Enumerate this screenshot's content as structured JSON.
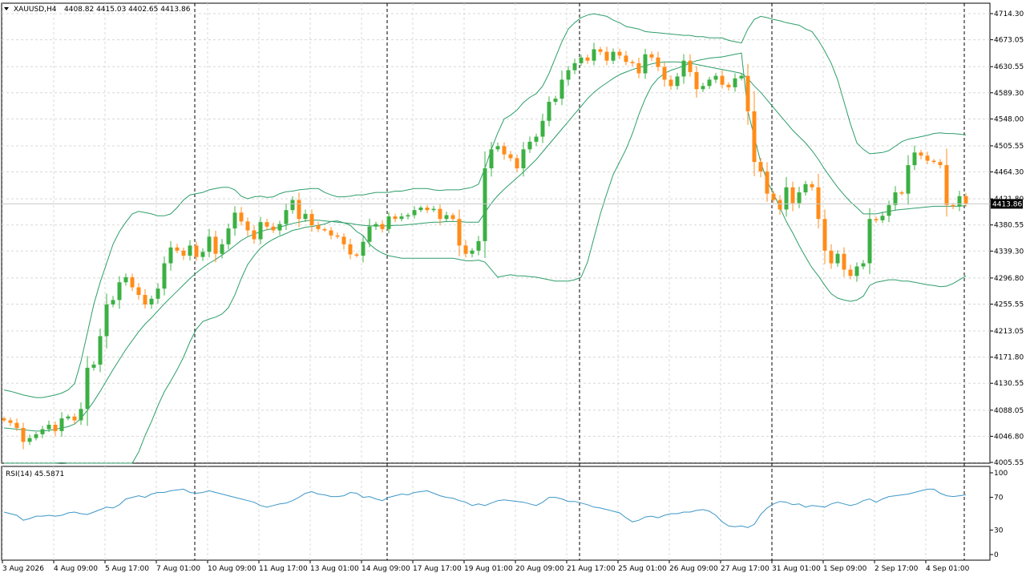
{
  "header": {
    "symbol_timeframe": "XAUUSD,H4",
    "ohlc": "4408.82 4415.03 4402.65 4413.86"
  },
  "price_axis": {
    "labels": [
      "4714.30",
      "4673.05",
      "4630.55",
      "4589.30",
      "4548.00",
      "4505.55",
      "4464.30",
      "4421.80",
      "4380.55",
      "4339.30",
      "4296.80",
      "4255.55",
      "4213.05",
      "4171.80",
      "4130.55",
      "4088.05",
      "4046.80",
      "4005.55"
    ],
    "current_price": "4413.86"
  },
  "rsi_panel": {
    "title": "RSI(14) 45.5871",
    "labels": [
      "100",
      "70",
      "30",
      "0"
    ],
    "levels": [
      100,
      70,
      30,
      0
    ]
  },
  "time_axis": {
    "labels": [
      "3 Aug 2026",
      "4 Aug 09:00",
      "5 Aug 17:00",
      "7 Aug 01:00",
      "10 Aug 09:00",
      "11 Aug 17:00",
      "13 Aug 01:00",
      "14 Aug 09:00",
      "17 Aug 17:00",
      "19 Aug 01:00",
      "20 Aug 09:00",
      "21 Aug 17:00",
      "25 Aug 01:00",
      "26 Aug 09:00",
      "27 Aug 17:00",
      "31 Aug 01:00",
      "1 Sep 09:00",
      "2 Sep 17:00",
      "4 Sep 01:00"
    ]
  },
  "colors": {
    "bull": "#3cb043",
    "bear": "#ff8c1a",
    "band": "#2e9e6a",
    "rsi": "#3c96c8",
    "grid": "#d8d8d8",
    "separator": "#000000"
  },
  "chart_data": {
    "type": "candlestick",
    "timeframe": "H4",
    "ylim": [
      4005.55,
      4714.3
    ],
    "bull_color": "#3cb043",
    "bear_color": "#ff8c1a",
    "close": [
      4072,
      4068,
      4060,
      4038,
      4044,
      4050,
      4058,
      4065,
      4055,
      4075,
      4078,
      4072,
      4090,
      4155,
      4160,
      4205,
      4255,
      4262,
      4290,
      4298,
      4282,
      4270,
      4255,
      4264,
      4280,
      4320,
      4345,
      4340,
      4332,
      4348,
      4330,
      4338,
      4362,
      4335,
      4350,
      4375,
      4400,
      4386,
      4372,
      4358,
      4385,
      4378,
      4372,
      4382,
      4404,
      4420,
      4390,
      4398,
      4380,
      4374,
      4372,
      4364,
      4362,
      4350,
      4334,
      4332,
      4354,
      4378,
      4382,
      4374,
      4394,
      4390,
      4394,
      4396,
      4404,
      4408,
      4404,
      4406,
      4390,
      4396,
      4390,
      4348,
      4335,
      4340,
      4355,
      4470,
      4500,
      4505,
      4492,
      4486,
      4470,
      4500,
      4512,
      4520,
      4545,
      4575,
      4580,
      4610,
      4625,
      4636,
      4645,
      4640,
      4658,
      4654,
      4640,
      4654,
      4648,
      4638,
      4636,
      4620,
      4650,
      4645,
      4630,
      4610,
      4600,
      4615,
      4640,
      4622,
      4595,
      4600,
      4610,
      4616,
      4602,
      4598,
      4612,
      4616,
      4560,
      4480,
      4465,
      4430,
      4420,
      4405,
      4440,
      4415,
      4432,
      4445,
      4440,
      4390,
      4340,
      4320,
      4335,
      4310,
      4300,
      4315,
      4320,
      4390,
      4388,
      4395,
      4412,
      4432,
      4430,
      4475,
      4495,
      4490,
      4482,
      4480,
      4475,
      4412,
      4410,
      4426,
      4414
    ],
    "bollinger": {
      "upper": [
        4120,
        4118,
        4115,
        4112,
        4110,
        4108,
        4108,
        4110,
        4112,
        4115,
        4120,
        4130,
        4165,
        4210,
        4255,
        4290,
        4320,
        4350,
        4370,
        4385,
        4398,
        4402,
        4400,
        4398,
        4395,
        4395,
        4398,
        4408,
        4420,
        4428,
        4430,
        4432,
        4436,
        4438,
        4440,
        4440,
        4436,
        4426,
        4422,
        4425,
        4426,
        4424,
        4425,
        4430,
        4433,
        4434,
        4436,
        4437,
        4438,
        4438,
        4432,
        4428,
        4425,
        4425,
        4426,
        4428,
        4428,
        4430,
        4432,
        4432,
        4432,
        4434,
        4434,
        4436,
        4438,
        4438,
        4438,
        4436,
        4435,
        4436,
        4436,
        4436,
        4438,
        4440,
        4445,
        4470,
        4500,
        4526,
        4548,
        4554,
        4562,
        4574,
        4582,
        4588,
        4600,
        4620,
        4645,
        4670,
        4690,
        4700,
        4708,
        4712,
        4714,
        4712,
        4710,
        4704,
        4700,
        4694,
        4692,
        4690,
        4686,
        4685,
        4684,
        4683,
        4682,
        4681,
        4680,
        4680,
        4678,
        4678,
        4676,
        4676,
        4676,
        4672,
        4670,
        4668,
        4690,
        4705,
        4710,
        4708,
        4705,
        4703,
        4700,
        4698,
        4696,
        4690,
        4686,
        4672,
        4655,
        4636,
        4610,
        4575,
        4540,
        4510,
        4500,
        4493,
        4494,
        4495,
        4498,
        4505,
        4512,
        4516,
        4518,
        4520,
        4522,
        4525,
        4526,
        4525,
        4525,
        4524,
        4523
      ],
      "middle": [
        4060,
        4059,
        4058,
        4057,
        4056,
        4055,
        4055,
        4056,
        4058,
        4060,
        4062,
        4066,
        4075,
        4088,
        4102,
        4118,
        4135,
        4152,
        4168,
        4184,
        4198,
        4212,
        4224,
        4234,
        4245,
        4256,
        4266,
        4276,
        4286,
        4296,
        4305,
        4313,
        4320,
        4326,
        4333,
        4340,
        4348,
        4356,
        4362,
        4366,
        4370,
        4373,
        4375,
        4377,
        4380,
        4383,
        4385,
        4387,
        4388,
        4388,
        4387,
        4386,
        4385,
        4384,
        4383,
        4381,
        4380,
        4379,
        4379,
        4379,
        4379,
        4380,
        4380,
        4381,
        4382,
        4383,
        4384,
        4385,
        4385,
        4386,
        4386,
        4386,
        4385,
        4385,
        4385,
        4400,
        4415,
        4427,
        4437,
        4446,
        4455,
        4464,
        4474,
        4484,
        4496,
        4508,
        4520,
        4532,
        4544,
        4556,
        4568,
        4580,
        4590,
        4598,
        4605,
        4612,
        4618,
        4622,
        4626,
        4629,
        4632,
        4635,
        4637,
        4638,
        4638,
        4638,
        4637,
        4636,
        4634,
        4632,
        4630,
        4628,
        4626,
        4624,
        4622,
        4620,
        4612,
        4600,
        4590,
        4578,
        4566,
        4554,
        4542,
        4530,
        4520,
        4510,
        4498,
        4484,
        4468,
        4454,
        4440,
        4428,
        4417,
        4408,
        4398,
        4398,
        4398,
        4400,
        4402,
        4404,
        4405,
        4406,
        4407,
        4408,
        4409,
        4410,
        4410,
        4410,
        4410,
        4410,
        4411
      ],
      "lower": [
        4000,
        4000,
        4001,
        4002,
        4003,
        4002,
        4002,
        4002,
        4004,
        4005,
        4004,
        4002,
        3985,
        3966,
        3949,
        3946,
        3950,
        3954,
        3966,
        3983,
        3998,
        4022,
        4048,
        4070,
        4095,
        4117,
        4134,
        4152,
        4172,
        4196,
        4216,
        4228,
        4232,
        4235,
        4240,
        4250,
        4270,
        4296,
        4318,
        4332,
        4344,
        4352,
        4358,
        4363,
        4367,
        4372,
        4374,
        4377,
        4378,
        4380,
        4382,
        4386,
        4387,
        4384,
        4380,
        4370,
        4364,
        4350,
        4342,
        4336,
        4332,
        4330,
        4328,
        4328,
        4328,
        4328,
        4328,
        4328,
        4328,
        4328,
        4328,
        4326,
        4324,
        4324,
        4325,
        4322,
        4310,
        4298,
        4300,
        4302,
        4300,
        4300,
        4299,
        4298,
        4296,
        4294,
        4292,
        4292,
        4292,
        4294,
        4298,
        4322,
        4360,
        4398,
        4430,
        4460,
        4480,
        4500,
        4525,
        4555,
        4580,
        4600,
        4612,
        4620,
        4625,
        4628,
        4632,
        4636,
        4640,
        4642,
        4644,
        4645,
        4646,
        4648,
        4650,
        4652,
        4560,
        4520,
        4480,
        4450,
        4430,
        4408,
        4386,
        4368,
        4348,
        4330,
        4313,
        4300,
        4285,
        4272,
        4265,
        4262,
        4260,
        4262,
        4268,
        4285,
        4290,
        4292,
        4294,
        4294,
        4292,
        4292,
        4290,
        4288,
        4286,
        4285,
        4283,
        4284,
        4288,
        4294,
        4300
      ]
    },
    "rsi": {
      "name": "RSI(14)",
      "current": 45.5871,
      "ylim": [
        0,
        100
      ],
      "levels": [
        70,
        30
      ],
      "values": [
        52,
        50,
        48,
        42,
        44,
        47,
        47,
        48,
        47,
        48,
        51,
        52,
        50,
        49,
        52,
        55,
        58,
        57,
        61,
        68,
        70,
        72,
        70,
        74,
        76,
        76,
        78,
        79,
        80,
        76,
        75,
        76,
        78,
        76,
        74,
        72,
        70,
        68,
        66,
        64,
        60,
        58,
        60,
        62,
        63,
        66,
        70,
        75,
        77,
        74,
        73,
        71,
        71,
        72,
        76,
        75,
        70,
        71,
        68,
        66,
        70,
        72,
        74,
        73,
        76,
        77,
        78,
        75,
        72,
        70,
        69,
        66,
        64,
        60,
        62,
        60,
        63,
        66,
        67,
        66,
        65,
        64,
        62,
        60,
        64,
        70,
        70,
        68,
        65,
        65,
        63,
        61,
        58,
        57,
        55,
        53,
        51,
        45,
        40,
        42,
        46,
        47,
        45,
        48,
        50,
        50,
        52,
        52,
        54,
        55,
        53,
        48,
        40,
        35,
        34,
        35,
        33,
        37,
        49,
        57,
        62,
        65,
        64,
        61,
        62,
        58,
        60,
        59,
        58,
        62,
        64,
        62,
        60,
        62,
        66,
        68,
        64,
        68,
        71,
        72,
        73,
        74,
        76,
        78,
        80,
        80,
        75,
        72,
        71,
        72,
        73
      ]
    }
  }
}
